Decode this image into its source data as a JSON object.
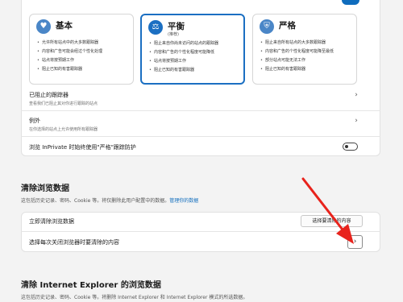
{
  "tracking_modes": [
    {
      "icon": "♥",
      "title": "基本",
      "subtitle": "",
      "bullets": [
        "允许所有站点中的大多数跟踪器",
        "内容和广告可能会经过个性化处理",
        "站点将按预期工作",
        "阻止已知的有害跟踪器"
      ]
    },
    {
      "icon": "⚖",
      "title": "平衡",
      "subtitle": "(推荐)",
      "bullets": [
        "阻止来自你尚未访问的站点的跟踪器",
        "内容和广告的个性化程度可能降低",
        "站点将按预期工作",
        "阻止已知的有害跟踪器"
      ]
    },
    {
      "icon": "⛨",
      "title": "严格",
      "subtitle": "",
      "bullets": [
        "阻止来自所有站点的大多数跟踪器",
        "内容和广告的个性化程度可能降至最低",
        "部分站点可能无法工作",
        "阻止已知的有害跟踪器"
      ]
    }
  ],
  "blocked_trackers": {
    "title": "已阻止的跟踪器",
    "desc": "查看我们已阻止其对你进行跟踪的站点"
  },
  "exceptions": {
    "title": "例外",
    "desc": "在你选择的站点上允许使用所有跟踪器"
  },
  "inprivate": {
    "label": "浏览 InPrivate 时始终使用\"严格\"跟踪防护",
    "enabled": false
  },
  "clear_data": {
    "title": "清除浏览数据",
    "desc": "这包括历史记录、密码、Cookie 等。将仅删除此用户配置中的数据。",
    "link": "管理你的数据",
    "now_label": "立即清除浏览数据",
    "choose_button": "选择要清除的内容",
    "on_close_label": "选择每次关闭浏览器时要清除的内容"
  },
  "ie_section": {
    "title": "清除 Internet Explorer 的浏览数据",
    "desc": "这包括历史记录、密码、Cookie 等。将删除 Internet Explorer 和 Internet Explorer 模式的所选数据。"
  },
  "icons": {
    "chevron": "›",
    "annotation": "red-arrow"
  },
  "colors": {
    "accent": "#1b6fc2",
    "annotation": "#e8231c"
  }
}
